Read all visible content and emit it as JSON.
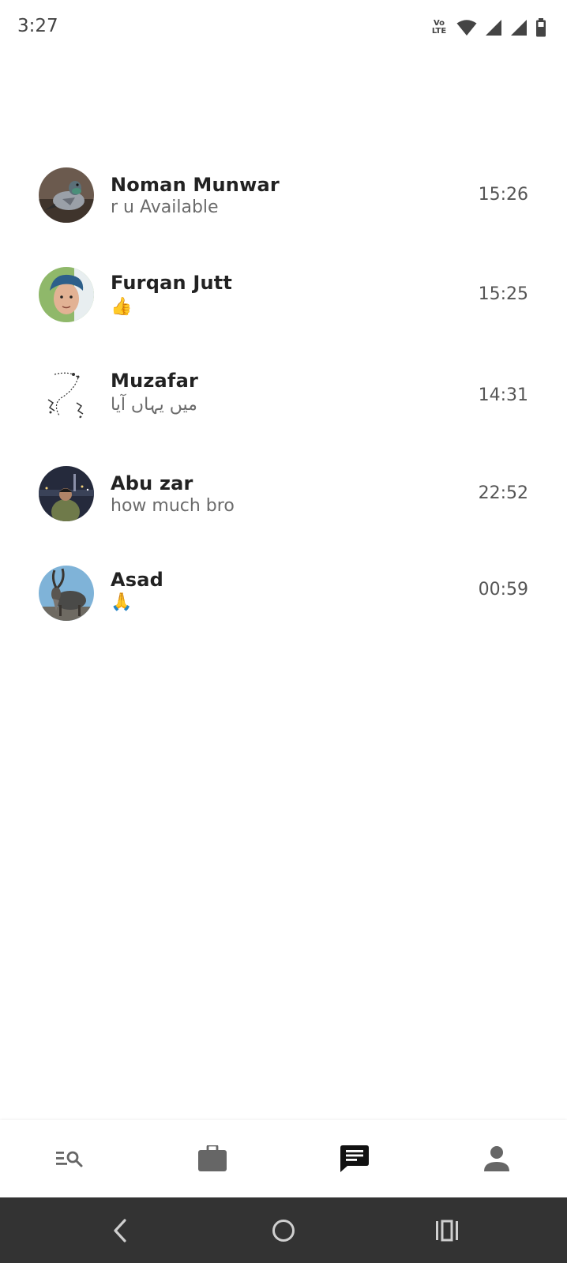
{
  "status_bar": {
    "time": "3:27",
    "volte_top": "Vo",
    "volte_bottom": "LTE",
    "icons": [
      "volte-lte-icon",
      "wifi-icon",
      "signal-icon",
      "signal-icon",
      "battery-icon"
    ]
  },
  "chats": [
    {
      "name": "Noman Munwar",
      "preview": "r u Available",
      "time": "15:26",
      "avatar": "pigeon-photo"
    },
    {
      "name": "Furqan Jutt",
      "preview": "👍",
      "time": "15:25",
      "avatar": "person-photo"
    },
    {
      "name": "Muzafar",
      "preview": "میں یہاں آیا",
      "time": "14:31",
      "avatar": "sketch-photo"
    },
    {
      "name": "Abu zar",
      "preview": "how much bro",
      "time": "22:52",
      "avatar": "night-photo"
    },
    {
      "name": "Asad",
      "preview": "🙏",
      "time": "00:59",
      "avatar": "markhor-photo"
    }
  ],
  "bottom_nav": {
    "items": [
      "search-list-icon",
      "briefcase-icon",
      "chat-icon",
      "person-icon"
    ],
    "active": "chat-icon",
    "colors": {
      "active": "#111111",
      "inactive": "#666666"
    }
  },
  "system_nav": {
    "items": [
      "back-icon",
      "home-icon",
      "recents-icon"
    ],
    "background": "#333333"
  }
}
